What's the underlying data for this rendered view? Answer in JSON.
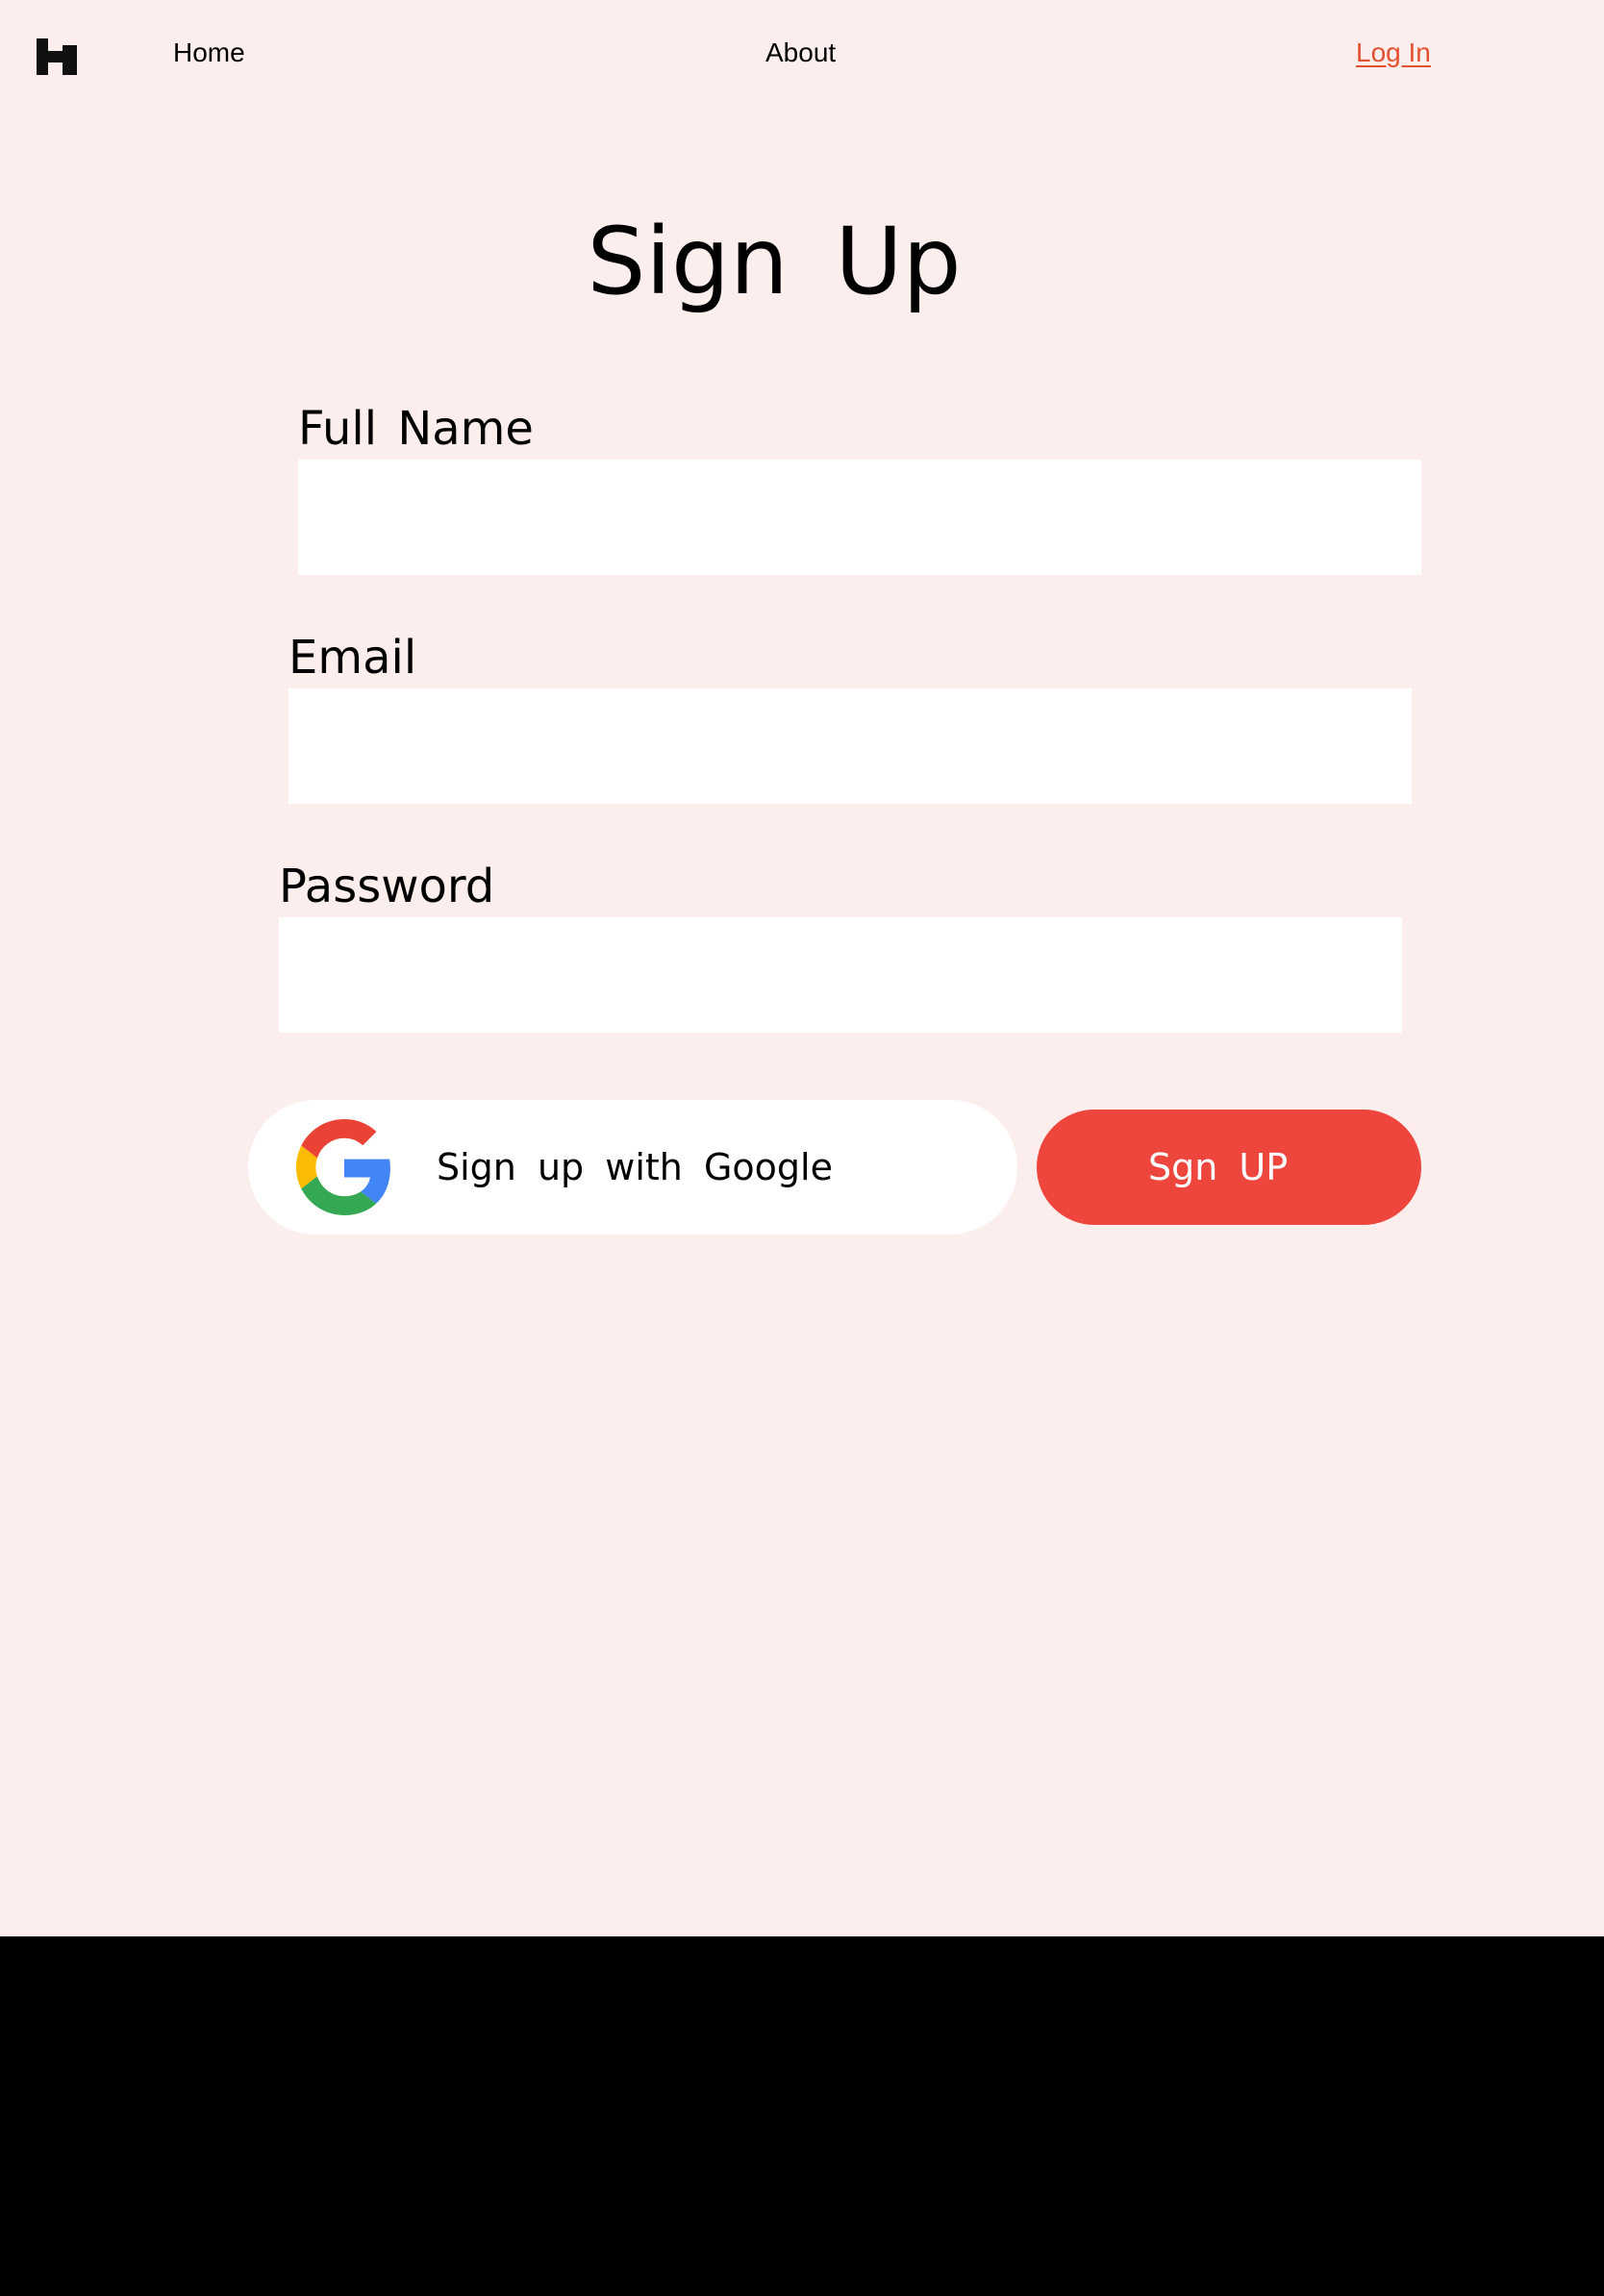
{
  "nav": {
    "home_label": "Home",
    "about_label": "About",
    "login_label": "Log In"
  },
  "page": {
    "title": "Sign Up"
  },
  "form": {
    "full_name_label": "Full Name",
    "full_name_value": "",
    "email_label": "Email",
    "email_value": "",
    "password_label": "Password",
    "password_value": ""
  },
  "actions": {
    "google_label": "Sign up with Google",
    "signup_label": "Sgn UP"
  },
  "colors": {
    "page_background": "#FDEEEE",
    "accent": "#EE453D",
    "login_link": "#E2502F",
    "footer": "#000000"
  },
  "icons": {
    "logo": "brand-logo-icon",
    "google": "google-icon"
  }
}
